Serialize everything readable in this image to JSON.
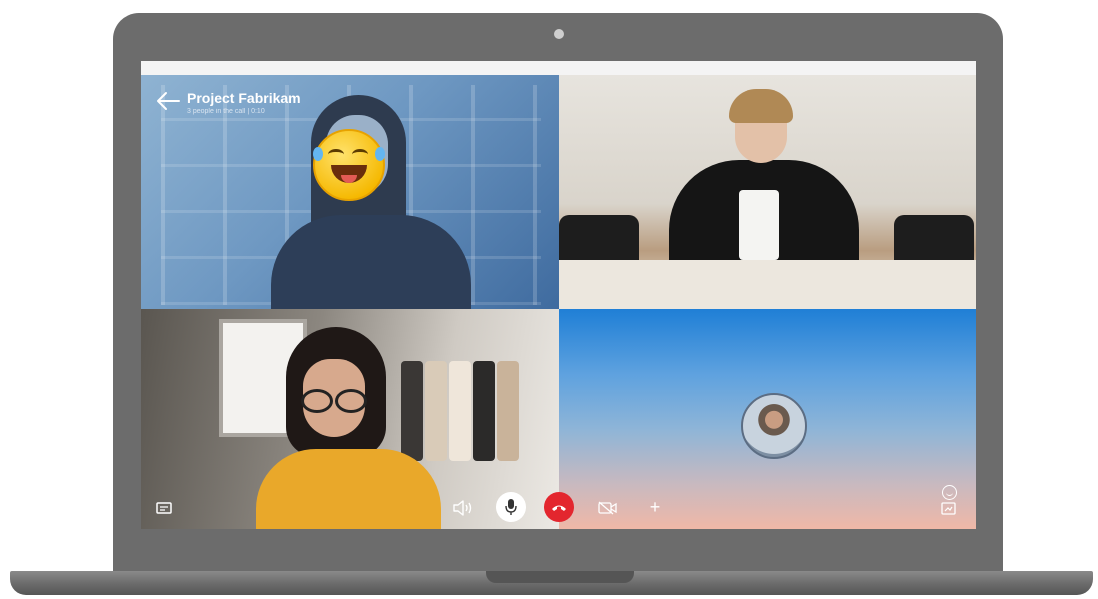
{
  "call": {
    "title": "Project Fabrikam",
    "subtitle": "3 people in the call | 0:10"
  },
  "controls": {
    "add_symbol": "+",
    "hangup_color": "#e3262e"
  },
  "icons": [
    "back-arrow-icon",
    "chat-icon",
    "speaker-icon",
    "microphone-icon",
    "hang-up-icon",
    "video-off-icon",
    "add-icon",
    "emoji-icon",
    "screen-share-icon"
  ]
}
